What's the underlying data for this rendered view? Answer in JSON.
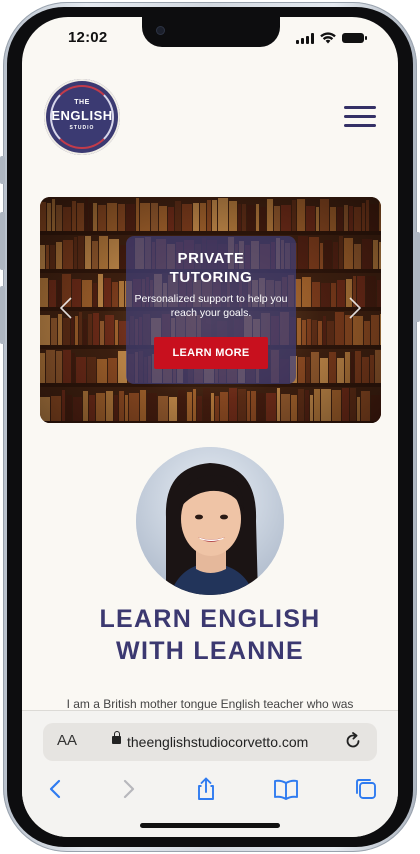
{
  "status_bar": {
    "time": "12:02"
  },
  "logo": {
    "line1": "THE",
    "line2": "ENGLISH",
    "line3": "STUDIO"
  },
  "hero": {
    "title_line1": "PRIVATE",
    "title_line2": "TUTORING",
    "subtitle": "Personalized support to help you reach your goals.",
    "button_label": "LEARN MORE"
  },
  "headline": {
    "line1": "LEARN ENGLISH",
    "line2": "WITH LEANNE"
  },
  "intro": "I am a British mother tongue English teacher who was",
  "browser": {
    "text_size_label": "AA",
    "url": "theenglishstudiocorvetto.com"
  },
  "colors": {
    "brand": "#3b3870",
    "accent_red": "#c8101e",
    "page_bg": "#faf8f3"
  }
}
